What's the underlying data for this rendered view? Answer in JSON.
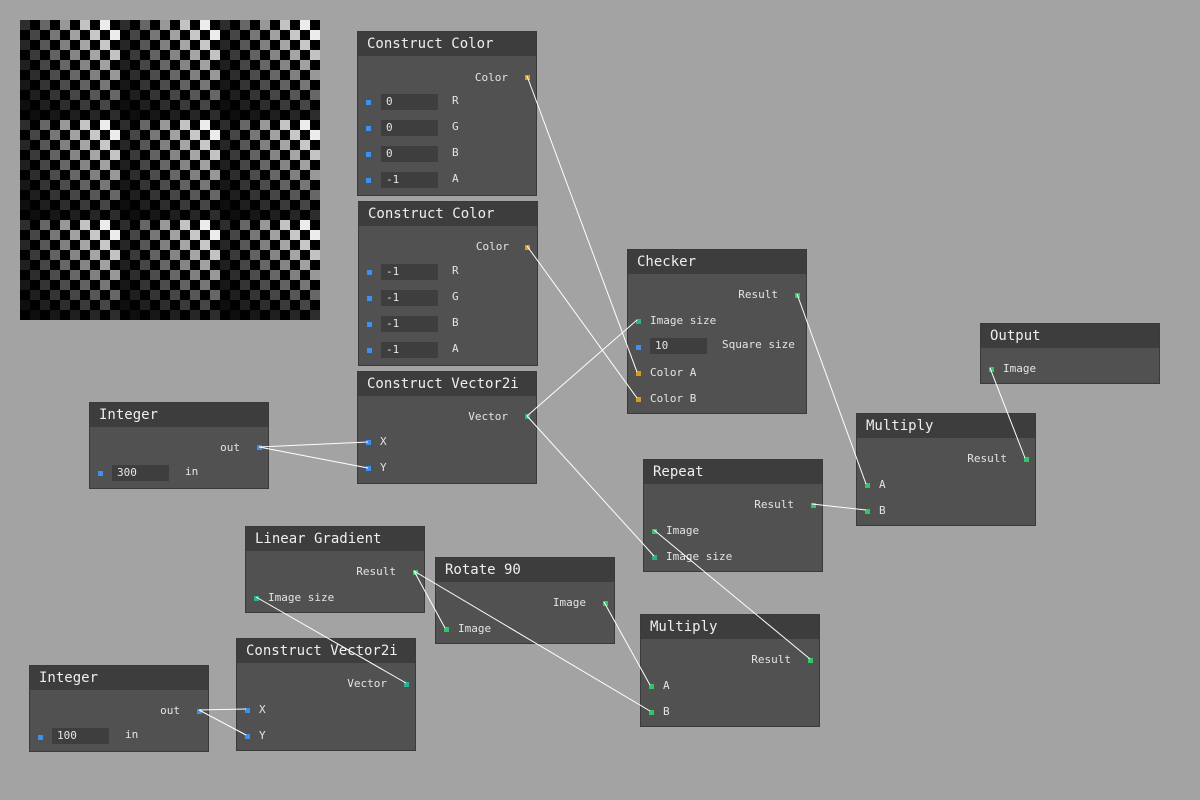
{
  "nodes": {
    "color1": {
      "title": "Construct Color",
      "out": "Color",
      "r_label": "R",
      "g_label": "G",
      "b_label": "B",
      "a_label": "A",
      "r": "0",
      "g": "0",
      "b": "0",
      "a": "-1"
    },
    "color2": {
      "title": "Construct Color",
      "out": "Color",
      "r_label": "R",
      "g_label": "G",
      "b_label": "B",
      "a_label": "A",
      "r": "-1",
      "g": "-1",
      "b": "-1",
      "a": "-1"
    },
    "vec1": {
      "title": "Construct Vector2i",
      "out": "Vector",
      "x_label": "X",
      "y_label": "Y"
    },
    "int1": {
      "title": "Integer",
      "out": "out",
      "in_label": "in",
      "value": "300"
    },
    "checker": {
      "title": "Checker",
      "out": "Result",
      "size_label": "Image size",
      "square_label": "Square size",
      "square_value": "10",
      "a_label": "Color A",
      "b_label": "Color B"
    },
    "output": {
      "title": "Output",
      "image_label": "Image"
    },
    "mult1": {
      "title": "Multiply",
      "out": "Result",
      "a_label": "A",
      "b_label": "B"
    },
    "repeat": {
      "title": "Repeat",
      "out": "Result",
      "image_label": "Image",
      "size_label": "Image size"
    },
    "linear": {
      "title": "Linear Gradient",
      "out": "Result",
      "size_label": "Image size"
    },
    "rotate": {
      "title": "Rotate 90",
      "out": "Image",
      "in_label": "Image"
    },
    "mult2": {
      "title": "Multiply",
      "out": "Result",
      "a_label": "A",
      "b_label": "B"
    },
    "vec2": {
      "title": "Construct Vector2i",
      "out": "Vector",
      "x_label": "X",
      "y_label": "Y"
    },
    "int2": {
      "title": "Integer",
      "out": "out",
      "in_label": "in",
      "value": "100"
    }
  },
  "colors": {
    "canvas": "#a3a3a3",
    "node_body": "#515151",
    "node_header": "#3d3d3d",
    "port_number": "#3d8ff0",
    "port_image": "#33c56a",
    "port_color": "#d79a1c",
    "port_vector": "#2cb090",
    "wire": "#ffffff"
  }
}
